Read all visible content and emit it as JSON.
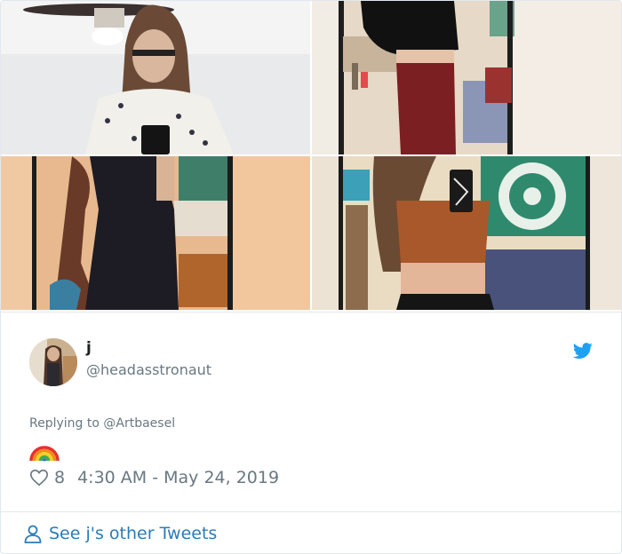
{
  "tweet": {
    "display_name": "j",
    "handle": "@headasstronaut",
    "replying_prefix": "Replying to ",
    "replying_to": "@Artbaesel",
    "like_count": "8",
    "timestamp": "4:30 AM - May 24, 2019"
  },
  "footer": {
    "see_more": "See j's other Tweets"
  },
  "colors": {
    "twitter_blue": "#1da1f2",
    "link_blue": "#2b7bb9",
    "muted": "#697882",
    "text": "#1c2022",
    "border": "#e1e8ed"
  },
  "icons": [
    "twitter-bird-icon",
    "heart-icon",
    "person-icon",
    "rainbow-emoji"
  ]
}
